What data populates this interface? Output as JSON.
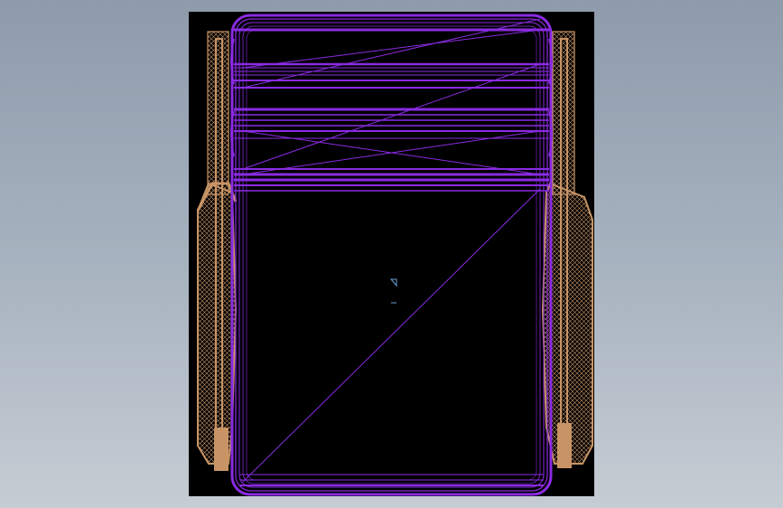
{
  "app": {
    "type": "cad-model-viewer"
  },
  "viewport": {
    "background": "#000000"
  },
  "colors": {
    "page_gradient_top": "#8e9bab",
    "page_gradient_bottom": "#c6ccd3",
    "wireframe_primary": "#8a2be2",
    "wireframe_secondary": "#c89466",
    "origin_marker": "#6aa0d6"
  },
  "model": {
    "view": "front-wireframe",
    "components": [
      "cylinder-wireframe-body",
      "left-tapered-support",
      "right-tapered-support"
    ]
  },
  "icons": {
    "origin_marker": "triangle-origin-icon"
  }
}
